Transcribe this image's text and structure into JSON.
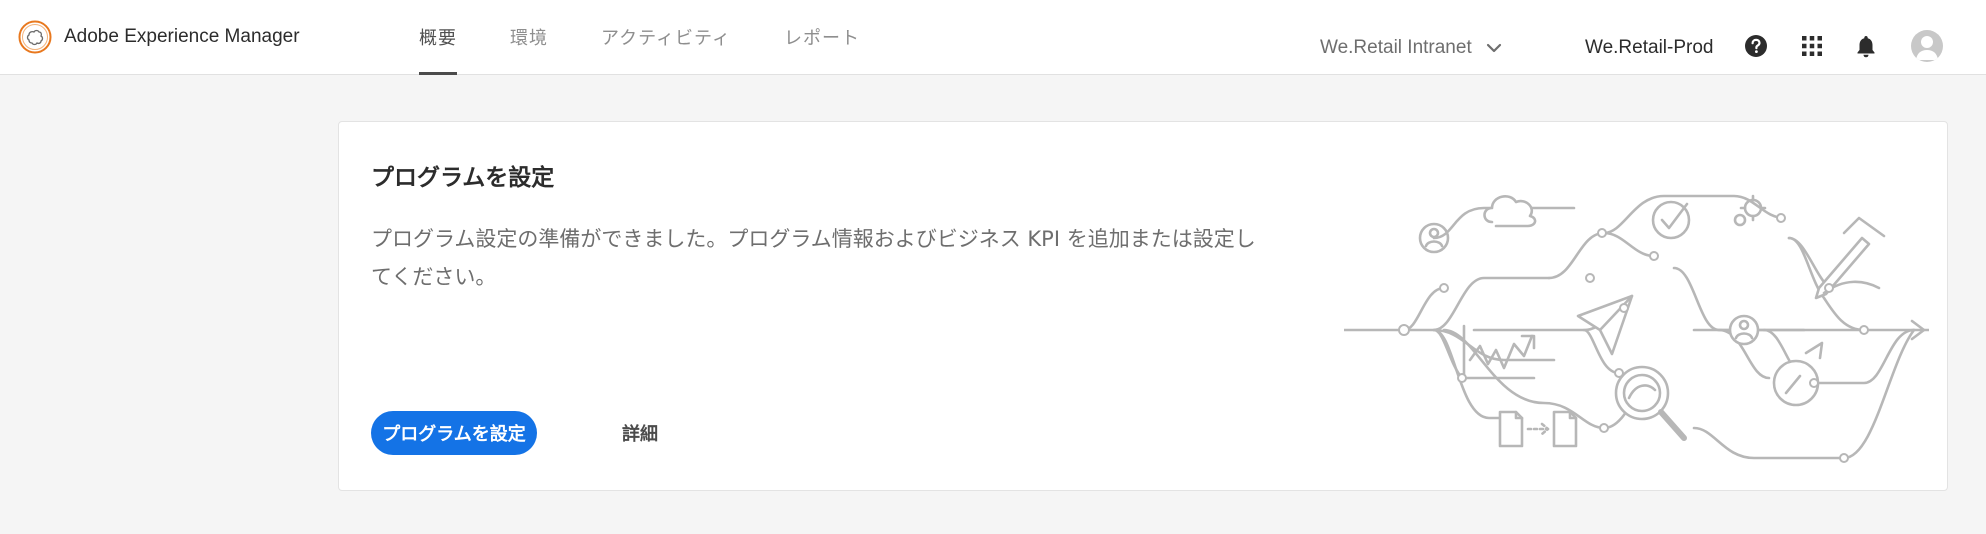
{
  "header": {
    "app_name": "Adobe Experience Manager",
    "logo_icon": "adobe-experience-cloud-logo-icon",
    "brand_color": "#e8781e",
    "tabs": [
      {
        "label": "概要",
        "active": true
      },
      {
        "label": "環境",
        "active": false
      },
      {
        "label": "アクティビティ",
        "active": false
      },
      {
        "label": "レポート",
        "active": false
      }
    ],
    "org_switcher": {
      "label": "We.Retail Intranet",
      "icon": "chevron-down-icon"
    },
    "environment": "We.Retail-Prod",
    "icons": [
      "help-icon",
      "apps-grid-icon",
      "bell-icon",
      "avatar"
    ]
  },
  "card": {
    "title": "プログラムを設定",
    "description": "プログラム設定の準備ができました。プログラム情報およびビジネス KPI を追加または設定してください。",
    "primary_button": "プログラムを設定",
    "secondary_link": "詳細",
    "accent_color": "#1473e6",
    "illustration_icons": [
      "user-icon",
      "cloud-icon",
      "checkmark-icon",
      "gears-icon",
      "pen-icon",
      "paper-plane-icon",
      "chart-icon",
      "magnifier-icon",
      "gauge-icon",
      "document-icon",
      "arrow-right-icon"
    ]
  }
}
